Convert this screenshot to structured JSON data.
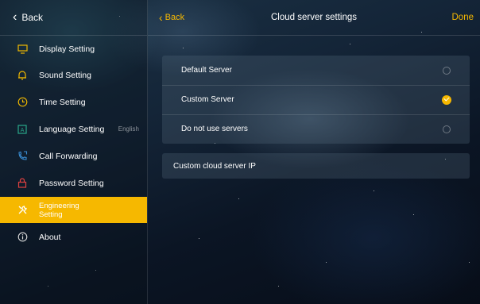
{
  "sidebar": {
    "back_label": "Back",
    "items": [
      {
        "label": "Display Setting",
        "icon": "monitor-icon"
      },
      {
        "label": "Sound Setting",
        "icon": "bell-icon"
      },
      {
        "label": "Time Setting",
        "icon": "clock-icon"
      },
      {
        "label": "Language Setting",
        "icon": "language-icon",
        "extra": "English"
      },
      {
        "label": "Call Forwarding",
        "icon": "phone-forward-icon"
      },
      {
        "label": "Password Setting",
        "icon": "lock-icon"
      },
      {
        "label": "Engineering Setting",
        "line1": "Engineering",
        "line2": "Setting",
        "icon": "wrench-icon",
        "active": true
      },
      {
        "label": "About",
        "icon": "info-icon"
      }
    ]
  },
  "header": {
    "back_label": "Back",
    "title": "Cloud server settings",
    "done_label": "Done"
  },
  "server_options": [
    {
      "label": "Default Server",
      "selected": false
    },
    {
      "label": "Custom Server",
      "selected": true
    },
    {
      "label": "Do not use servers",
      "selected": false
    }
  ],
  "custom_ip": {
    "label": "Custom cloud server IP"
  },
  "colors": {
    "accent": "#f6b800"
  }
}
